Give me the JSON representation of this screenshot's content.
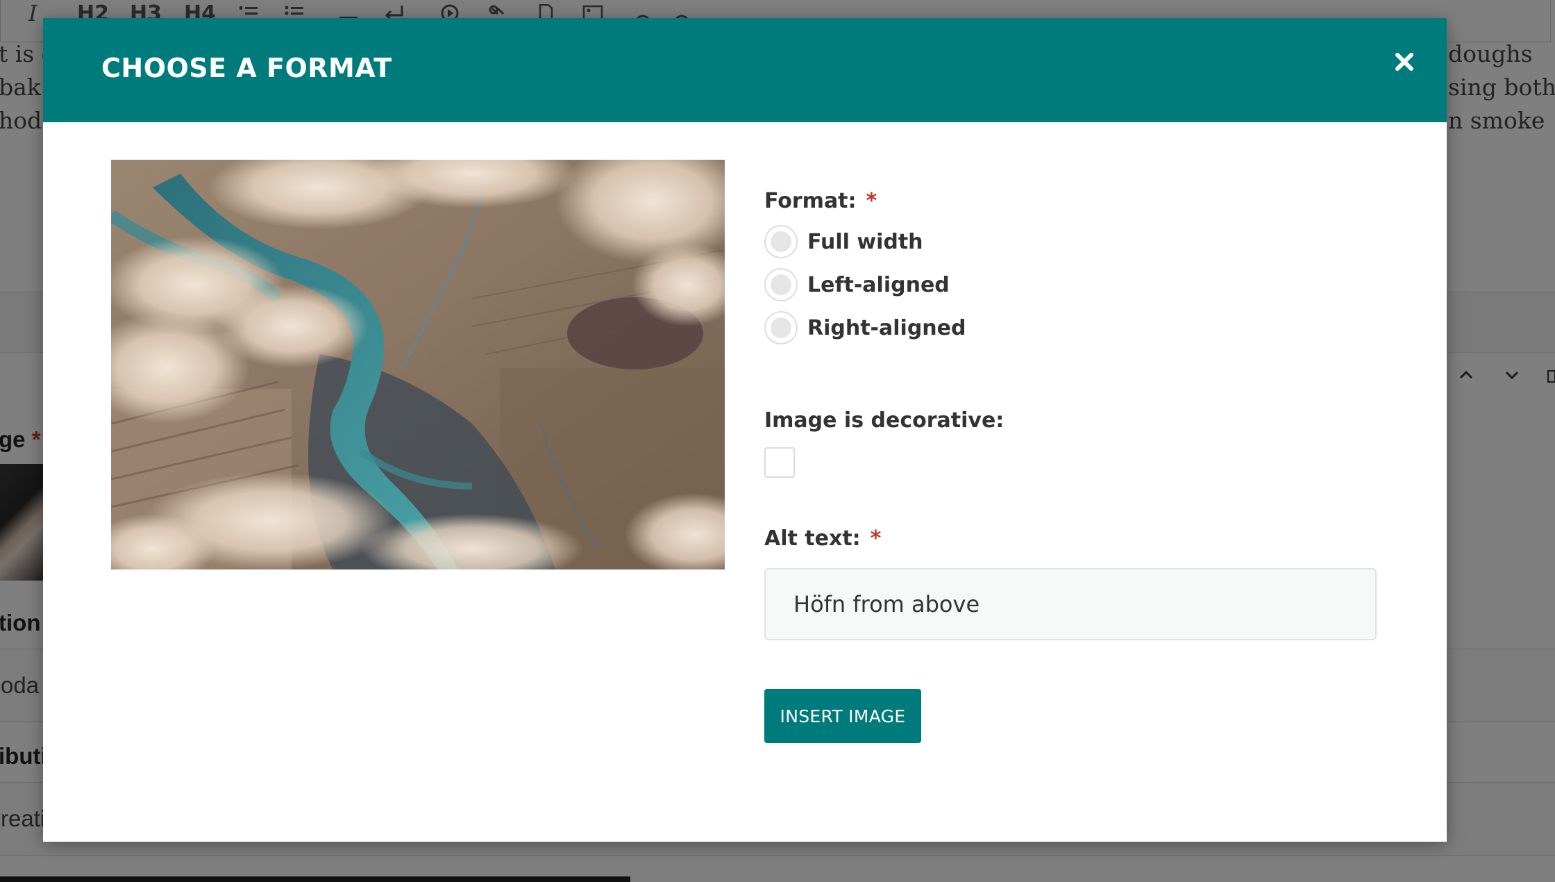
{
  "background": {
    "toolbar_buttons": [
      "H2",
      "H3",
      "H4"
    ],
    "toolbar_icons": [
      "italic-icon",
      "ordered-list-icon",
      "unordered-list-icon",
      "horizontal-rule-icon",
      "line-break-icon",
      "embed-media-icon",
      "link-icon",
      "document-icon",
      "image-icon",
      "undo-icon",
      "redo-icon"
    ],
    "text_left": [
      "t is g",
      " bak",
      "hods"
    ],
    "text_right": [
      "doughs",
      "sing both",
      "n smoke"
    ],
    "field_labels": [
      "ge",
      "tion",
      "ibuti"
    ],
    "field_values": [
      "oda",
      "reati"
    ]
  },
  "modal": {
    "title": "CHOOSE A FORMAT",
    "close_icon": "close-icon",
    "image_alt": "Höfn from above",
    "format": {
      "label": "Format:",
      "required_marker": "*",
      "options": [
        {
          "label": "Full width",
          "checked": false
        },
        {
          "label": "Left-aligned",
          "checked": false
        },
        {
          "label": "Right-aligned",
          "checked": false
        }
      ]
    },
    "decorative": {
      "label": "Image is decorative:",
      "checked": false
    },
    "alt_text": {
      "label": "Alt text:",
      "required_marker": "*",
      "value": "Höfn from above"
    },
    "insert_button": "INSERT IMAGE"
  },
  "colors": {
    "primary": "#007b7b",
    "required": "#c0392b"
  }
}
